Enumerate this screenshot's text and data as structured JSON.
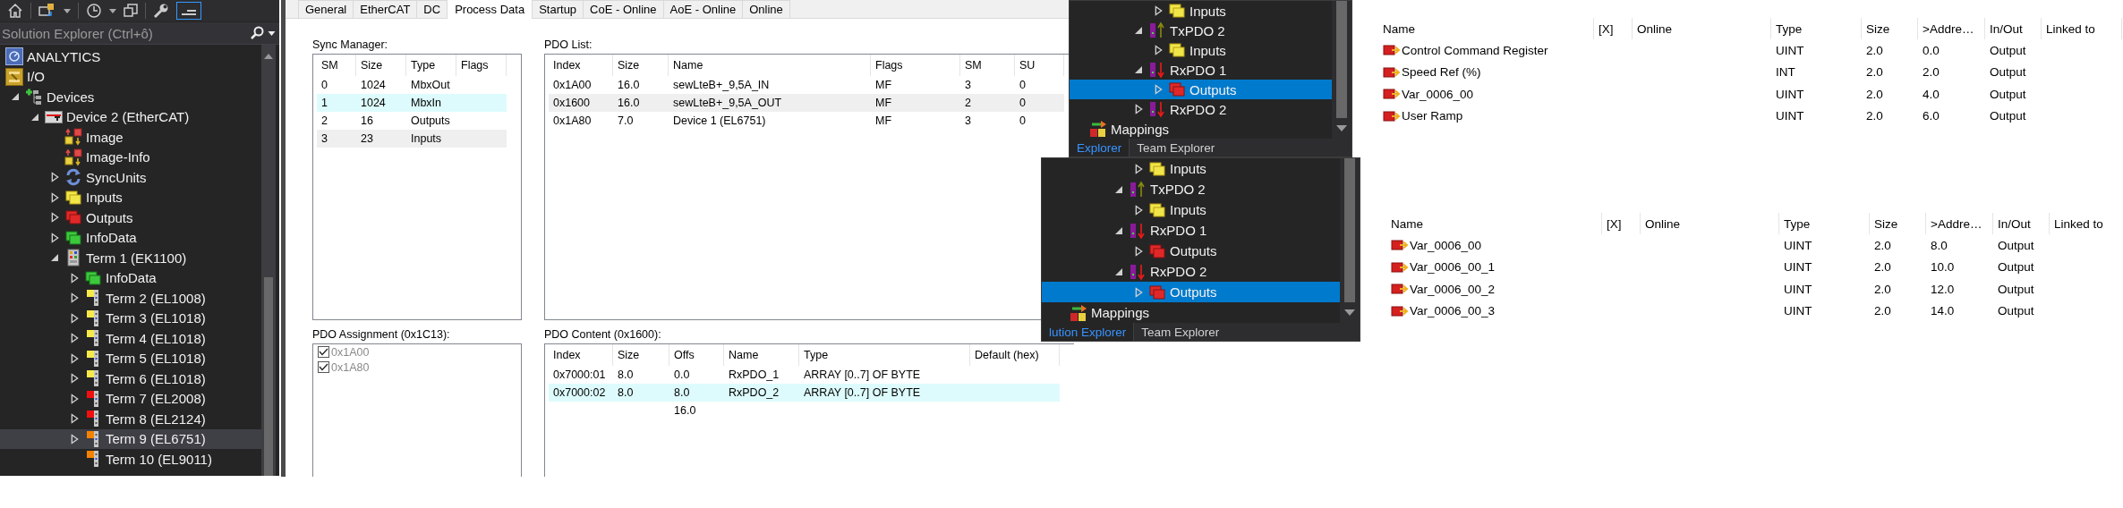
{
  "solution_explorer": {
    "search": {
      "placeholder": "Solution Explorer (Ctrl+ô)"
    },
    "tree": [
      {
        "label": "ANALYTICS",
        "kind": "analytics",
        "selected": false
      },
      {
        "label": "I/O",
        "kind": "io",
        "selected": false
      },
      {
        "label": "Devices",
        "kind": "devices",
        "expanded": true,
        "selected": false,
        "children": [
          {
            "label": "Device 2 (EtherCAT)",
            "kind": "ethercat",
            "expanded": true,
            "selected": false,
            "children": [
              {
                "label": "Image",
                "kind": "image",
                "selected": false
              },
              {
                "label": "Image-Info",
                "kind": "image",
                "selected": false
              },
              {
                "label": "SyncUnits",
                "kind": "sync",
                "expanded": false,
                "selected": false
              },
              {
                "label": "Inputs",
                "kind": "inputs",
                "expanded": false,
                "selected": false
              },
              {
                "label": "Outputs",
                "kind": "outputs",
                "expanded": false,
                "selected": false
              },
              {
                "label": "InfoData",
                "kind": "infodata",
                "expanded": false,
                "selected": false
              },
              {
                "label": "Term 1 (EK1100)",
                "kind": "coupler",
                "expanded": true,
                "selected": false,
                "children": [
                  {
                    "label": "InfoData",
                    "kind": "infodata",
                    "expanded": false,
                    "selected": false
                  },
                  {
                    "label": "Term 2 (EL1008)",
                    "kind": "terminal",
                    "color": "#f5ea4a",
                    "expanded": false,
                    "selected": false
                  },
                  {
                    "label": "Term 3 (EL1018)",
                    "kind": "terminal",
                    "color": "#f5ea4a",
                    "expanded": false,
                    "selected": false
                  },
                  {
                    "label": "Term 4 (EL1018)",
                    "kind": "terminal",
                    "color": "#f5ea4a",
                    "expanded": false,
                    "selected": false
                  },
                  {
                    "label": "Term 5 (EL1018)",
                    "kind": "terminal",
                    "color": "#f5ea4a",
                    "expanded": false,
                    "selected": false
                  },
                  {
                    "label": "Term 6 (EL1018)",
                    "kind": "terminal",
                    "color": "#f5ea4a",
                    "expanded": false,
                    "selected": false
                  },
                  {
                    "label": "Term 7 (EL2008)",
                    "kind": "terminal",
                    "color": "#f01010",
                    "expanded": false,
                    "selected": false
                  },
                  {
                    "label": "Term 8 (EL2124)",
                    "kind": "terminal",
                    "color": "#f01010",
                    "expanded": false,
                    "selected": false
                  },
                  {
                    "label": "Term 9 (EL6751)",
                    "kind": "terminal",
                    "color": "#f58200",
                    "expanded": false,
                    "selected": true
                  },
                  {
                    "label": "Term 10 (EL9011)",
                    "kind": "terminal",
                    "color": "#f58200",
                    "selected": false
                  }
                ]
              }
            ]
          }
        ]
      }
    ]
  },
  "process_data": {
    "tabs": [
      {
        "label": "General",
        "selected": false
      },
      {
        "label": "EtherCAT",
        "selected": false
      },
      {
        "label": "DC",
        "selected": false
      },
      {
        "label": "Process Data",
        "selected": true
      },
      {
        "label": "Startup",
        "selected": false
      },
      {
        "label": "CoE - Online",
        "selected": false
      },
      {
        "label": "AoE - Online",
        "selected": false
      },
      {
        "label": "Online",
        "selected": false
      }
    ],
    "sync_manager": {
      "title": "Sync Manager:",
      "columns": [
        "SM",
        "Size",
        "Type",
        "Flags"
      ],
      "rows": [
        {
          "sm": "0",
          "size": "1024",
          "type": "MbxOut",
          "selected": false,
          "marked": false
        },
        {
          "sm": "1",
          "size": "1024",
          "type": "MbxIn",
          "selected": true,
          "marked": false
        },
        {
          "sm": "2",
          "size": "16",
          "type": "Outputs",
          "selected": false,
          "marked": false
        },
        {
          "sm": "3",
          "size": "23",
          "type": "Inputs",
          "selected": false,
          "marked": true
        }
      ]
    },
    "pdo_list": {
      "title": "PDO List:",
      "columns": [
        "Index",
        "Size",
        "Name",
        "Flags",
        "SM",
        "SU"
      ],
      "rows": [
        {
          "index": "0x1A00",
          "size": "16.0",
          "name": "sewLteB+_9,5A_IN",
          "flags": "MF",
          "sm": "3",
          "su": "0",
          "selected": false,
          "marked": false
        },
        {
          "index": "0x1600",
          "size": "16.0",
          "name": "sewLteB+_9,5A_OUT",
          "flags": "MF",
          "sm": "2",
          "su": "0",
          "selected": false,
          "marked": true
        },
        {
          "index": "0x1A80",
          "size": "7.0",
          "name": "Device 1 (EL6751)",
          "flags": "MF",
          "sm": "3",
          "su": "0",
          "selected": false,
          "marked": false
        }
      ]
    },
    "pdo_assignment": {
      "title": "PDO Assignment (0x1C13):",
      "items": [
        {
          "label": "0x1A00",
          "checked": true,
          "disabled": true
        },
        {
          "label": "0x1A80",
          "checked": true,
          "disabled": true
        }
      ]
    },
    "pdo_content": {
      "title": "PDO Content (0x1600):",
      "columns": [
        "Index",
        "Size",
        "Offs",
        "Name",
        "Type",
        "Default (hex)"
      ],
      "rows": [
        {
          "index": "0x7000:01",
          "size": "8.0",
          "offs": "0.0",
          "name": "RxPDO_1",
          "type": "ARRAY [0..7] OF BYTE",
          "selected": false,
          "marked": false
        },
        {
          "index": "0x7000:02",
          "size": "8.0",
          "offs": "8.0",
          "name": "RxPDO_2",
          "type": "ARRAY [0..7] OF BYTE",
          "selected": true,
          "marked": false
        },
        {
          "offs": "16.0",
          "selected": false,
          "marked": false
        }
      ]
    }
  },
  "explorer_panels": [
    {
      "tree": [
        {
          "children": [
            {
              "children": [
                {
                  "children": [
                    {
                      "children": [
                        {
                          "label": "Inputs",
                          "kind": "inputs",
                          "expanded": false,
                          "selected": false
                        }
                      ]
                    },
                    {
                      "label": "TxPDO 2",
                      "kind": "pdo-tx",
                      "expanded": true,
                      "selected": false,
                      "children": [
                        {
                          "label": "Inputs",
                          "kind": "inputs",
                          "expanded": false,
                          "selected": false
                        }
                      ]
                    },
                    {
                      "label": "RxPDO 1",
                      "kind": "pdo-rx",
                      "expanded": true,
                      "selected": false,
                      "children": [
                        {
                          "label": "Outputs",
                          "kind": "outputs",
                          "expanded": false,
                          "selected": true
                        }
                      ]
                    },
                    {
                      "label": "RxPDO 2",
                      "kind": "pdo-rx",
                      "expanded": false,
                      "selected": false
                    }
                  ]
                }
              ]
            }
          ]
        },
        {
          "label": "Mappings",
          "kind": "mappings",
          "selected": false
        }
      ],
      "tabs": [
        {
          "label": "Explorer",
          "selected": true
        },
        {
          "label": "Team Explorer",
          "selected": false
        }
      ]
    },
    {
      "tree": [
        {
          "children": [
            {
              "children": [
                {
                  "children": [
                    {
                      "children": [
                        {
                          "label": "Inputs",
                          "kind": "inputs",
                          "expanded": false,
                          "selected": false
                        }
                      ]
                    },
                    {
                      "label": "TxPDO 2",
                      "kind": "pdo-tx",
                      "expanded": true,
                      "selected": false,
                      "children": [
                        {
                          "label": "Inputs",
                          "kind": "inputs",
                          "expanded": false,
                          "selected": false
                        }
                      ]
                    },
                    {
                      "label": "RxPDO 1",
                      "kind": "pdo-rx",
                      "expanded": true,
                      "selected": false,
                      "children": [
                        {
                          "label": "Outputs",
                          "kind": "outputs",
                          "expanded": false,
                          "selected": false
                        }
                      ]
                    },
                    {
                      "label": "RxPDO 2",
                      "kind": "pdo-rx",
                      "expanded": true,
                      "selected": false,
                      "children": [
                        {
                          "label": "Outputs",
                          "kind": "outputs",
                          "expanded": false,
                          "selected": true
                        }
                      ]
                    }
                  ]
                }
              ]
            }
          ]
        },
        {
          "label": "Mappings",
          "kind": "mappings",
          "selected": false
        }
      ],
      "tabs": [
        {
          "label": "lution Explorer",
          "selected": true
        },
        {
          "label": "Team Explorer",
          "selected": false
        }
      ]
    }
  ],
  "variable_tables": [
    {
      "columns": [
        "Name",
        "[X]",
        "Online",
        "Type",
        "Size",
        ">Addre…",
        "In/Out",
        "Linked to"
      ],
      "rows": [
        {
          "name": "Control Command Register",
          "type": "UINT",
          "size": "2.0",
          "address": "0.0",
          "in_out": "Output"
        },
        {
          "name": "Speed Ref (%)",
          "type": "INT",
          "size": "2.0",
          "address": "2.0",
          "in_out": "Output"
        },
        {
          "name": "Var_0006_00",
          "type": "UINT",
          "size": "2.0",
          "address": "4.0",
          "in_out": "Output"
        },
        {
          "name": "User Ramp",
          "type": "UINT",
          "size": "2.0",
          "address": "6.0",
          "in_out": "Output"
        }
      ]
    },
    {
      "columns": [
        "Name",
        "[X]",
        "Online",
        "Type",
        "Size",
        ">Addre…",
        "In/Out",
        "Linked to"
      ],
      "rows": [
        {
          "name": "Var_0006_00",
          "type": "UINT",
          "size": "2.0",
          "address": "8.0",
          "in_out": "Output"
        },
        {
          "name": "Var_0006_00_1",
          "type": "UINT",
          "size": "2.0",
          "address": "10.0",
          "in_out": "Output"
        },
        {
          "name": "Var_0006_00_2",
          "type": "UINT",
          "size": "2.0",
          "address": "12.0",
          "in_out": "Output"
        },
        {
          "name": "Var_0006_00_3",
          "type": "UINT",
          "size": "2.0",
          "address": "14.0",
          "in_out": "Output"
        }
      ]
    }
  ]
}
